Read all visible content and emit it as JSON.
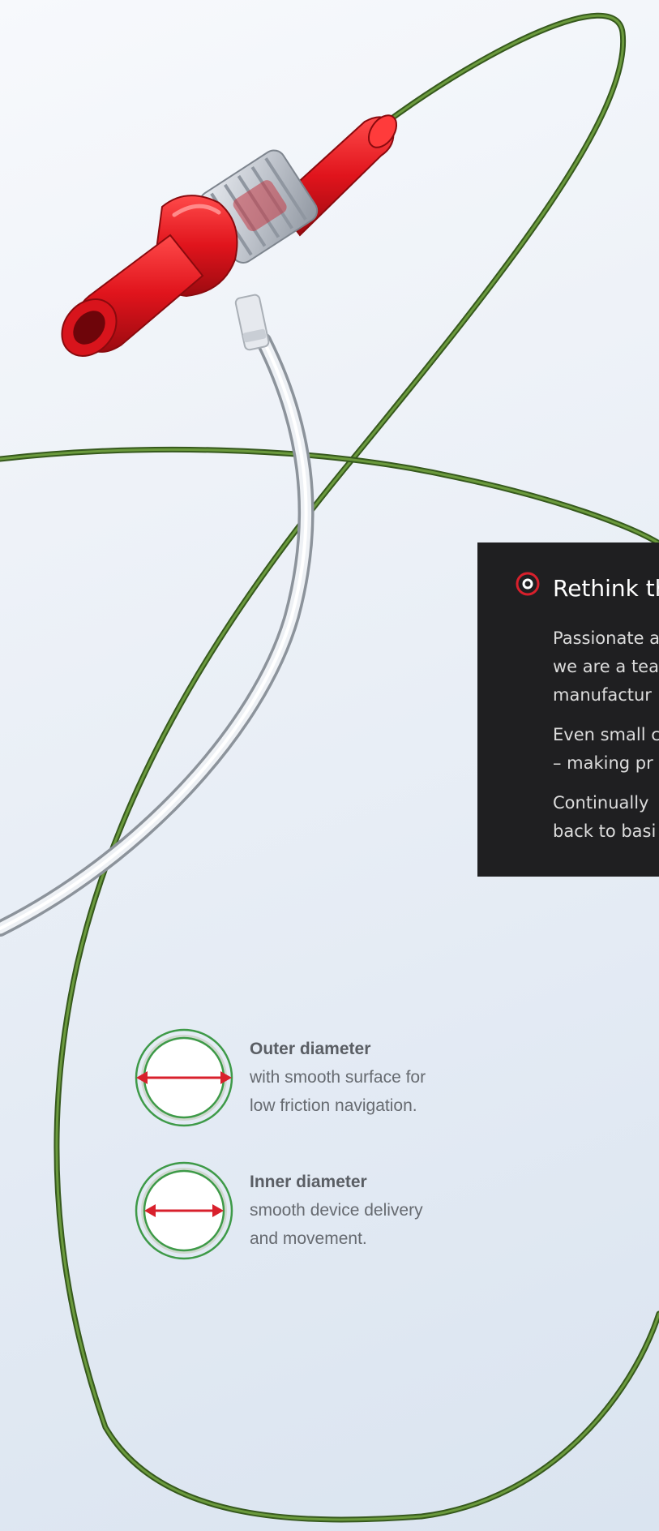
{
  "panel": {
    "title": "Rethink th",
    "paragraphs": [
      "Passionate a\nwe are a tea\nmanufactur",
      "Even small c\n– making pr",
      "Continually\nback to basi"
    ]
  },
  "specs": [
    {
      "title": "Outer diameter",
      "line1": "with smooth surface for",
      "line2": "low friction navigation."
    },
    {
      "title": "Inner diameter",
      "line1": "smooth device delivery",
      "line2": "and movement."
    }
  ],
  "colors": {
    "panel_background": "#1f1f21",
    "accent_red": "#d8202c",
    "ring_green": "#3e9a48",
    "wire_green": "#4d7c2c"
  }
}
